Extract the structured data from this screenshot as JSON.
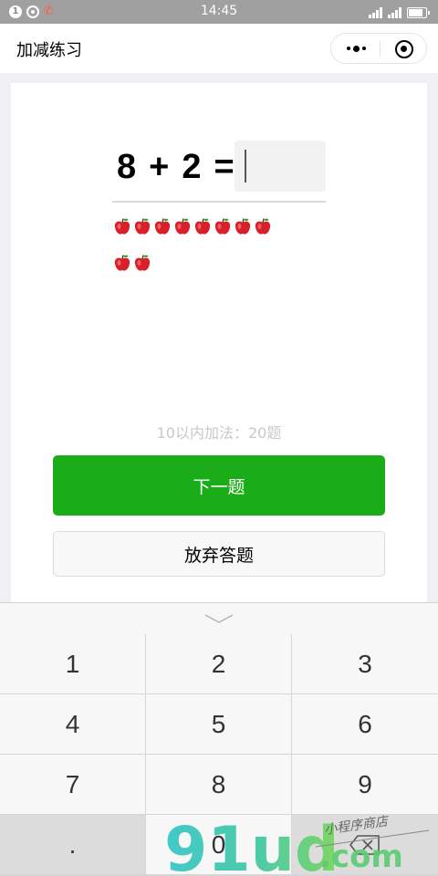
{
  "status_bar": {
    "notification_count": "1",
    "time": "14:45"
  },
  "nav": {
    "title": "加减练习"
  },
  "question": {
    "operand_a": "8",
    "operator": "+",
    "operand_b": "2",
    "equals": "=",
    "answer_value": ""
  },
  "apples": {
    "row1_count": 8,
    "row2_count": 2,
    "icon": "apple-icon"
  },
  "hint_text": "10以内加法：20题",
  "buttons": {
    "next": "下一题",
    "give_up": "放弃答题"
  },
  "keypad": {
    "keys": [
      "1",
      "2",
      "3",
      "4",
      "5",
      "6",
      "7",
      "8",
      "9",
      ".",
      "0",
      ""
    ]
  },
  "watermark": {
    "brand": "91ud",
    "domain": ".com",
    "tagline": "小程序商店"
  },
  "colors": {
    "primary_green": "#1aad19",
    "status_bar": "#a0a0a0",
    "apple_red": "#d8202a"
  }
}
